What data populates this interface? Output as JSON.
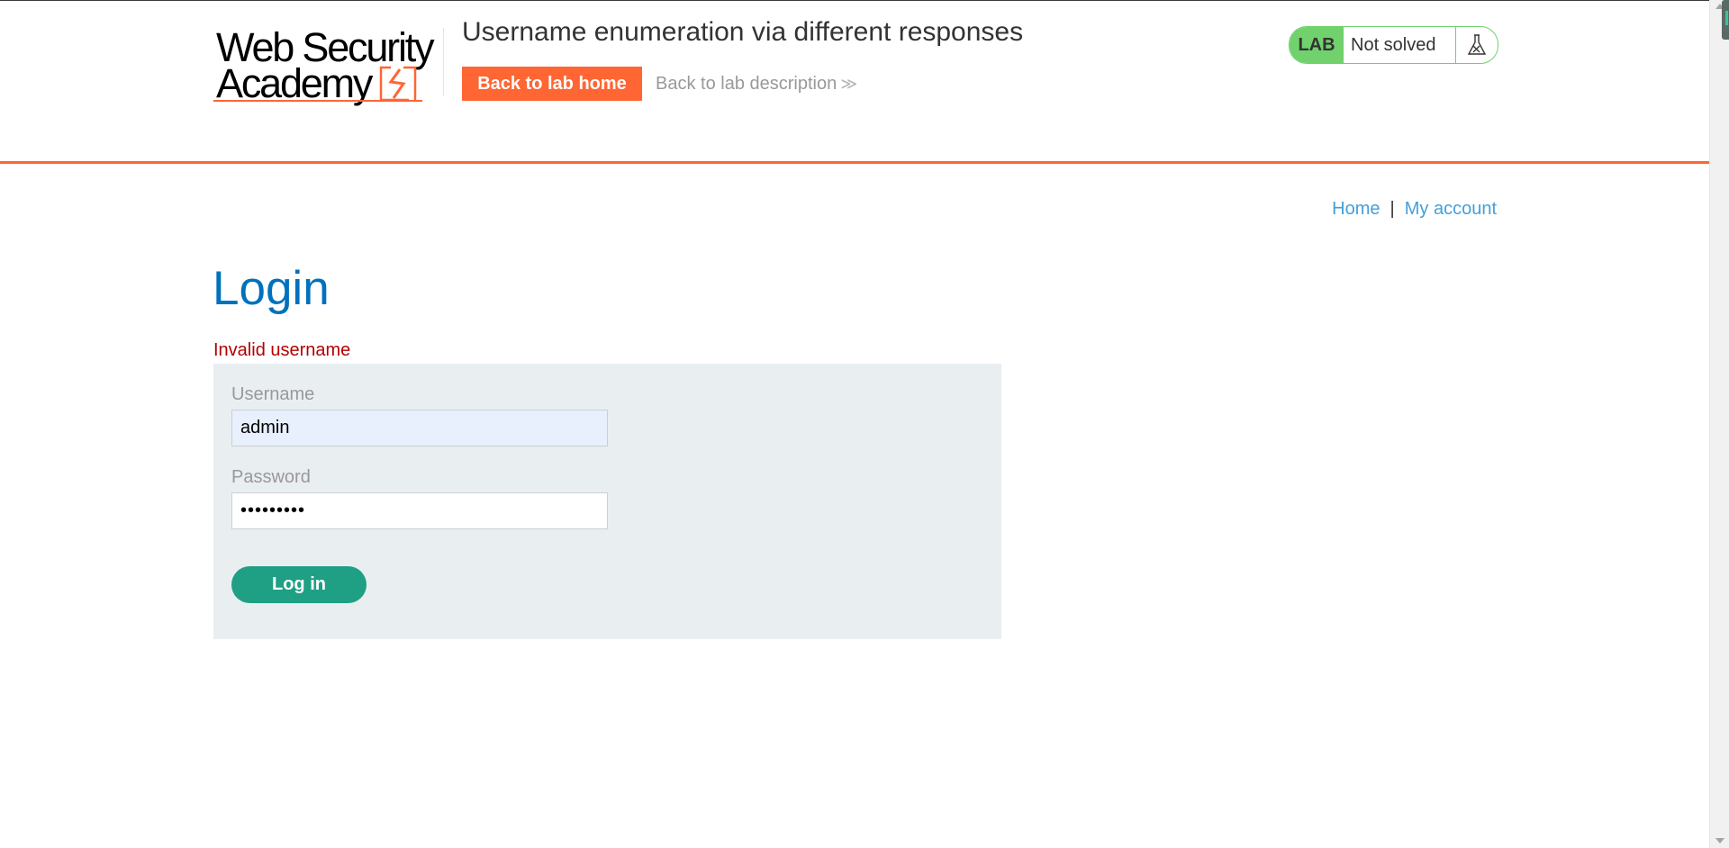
{
  "header": {
    "logo_line1": "Web Security",
    "logo_line2": "Academy",
    "lab_title": "Username enumeration via different responses",
    "back_home_label": "Back to lab home",
    "back_description_label": "Back to lab description",
    "back_description_chevron": "≫",
    "status_badge": "LAB",
    "status_text": "Not solved",
    "status_icon": "flask-icon"
  },
  "nav": {
    "home": "Home",
    "separator": "|",
    "my_account": "My account"
  },
  "page": {
    "title": "Login",
    "error": "Invalid username"
  },
  "form": {
    "username_label": "Username",
    "username_value": "admin",
    "password_label": "Password",
    "password_value": "•••••••••",
    "submit_label": "Log in"
  },
  "colors": {
    "accent_orange": "#ff6633",
    "link_blue": "#44a0d8",
    "title_blue": "#0071bc",
    "error_red": "#b50000",
    "success_green": "#70d16d",
    "button_teal": "#1f9f84",
    "form_bg": "#e9eef1"
  }
}
